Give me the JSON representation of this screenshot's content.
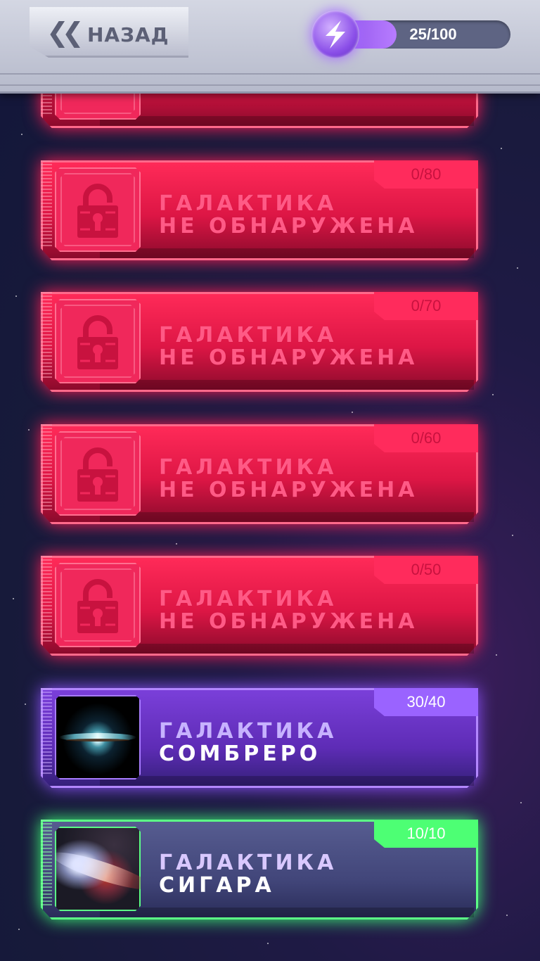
{
  "header": {
    "back_label": "НАЗАД",
    "energy": {
      "text": "25/100",
      "current": 25,
      "max": 100
    }
  },
  "colors": {
    "locked": "#ff2a58",
    "purple": "#7a3fd9",
    "green": "#4dff74",
    "energy": "#8a4ee8"
  },
  "galaxies": [
    {
      "state": "locked",
      "progress": "0/80",
      "line1": "ГАЛАКТИКА",
      "line2": "НЕ ОБНАРУЖЕНА",
      "icon": "lock-icon"
    },
    {
      "state": "locked",
      "progress": "0/70",
      "line1": "ГАЛАКТИКА",
      "line2": "НЕ ОБНАРУЖЕНА",
      "icon": "lock-icon"
    },
    {
      "state": "locked",
      "progress": "0/60",
      "line1": "ГАЛАКТИКА",
      "line2": "НЕ ОБНАРУЖЕНА",
      "icon": "lock-icon"
    },
    {
      "state": "locked",
      "progress": "0/50",
      "line1": "ГАЛАКТИКА",
      "line2": "НЕ ОБНАРУЖЕНА",
      "icon": "lock-icon"
    },
    {
      "state": "purple",
      "progress": "30/40",
      "line1": "ГАЛАКТИКА",
      "line2": "СОМБРЕРО",
      "icon": "sombrero-galaxy-image"
    },
    {
      "state": "green",
      "progress": "10/10",
      "line1": "ГАЛАКТИКА",
      "line2": "СИГАРА",
      "icon": "cigar-galaxy-image"
    }
  ]
}
